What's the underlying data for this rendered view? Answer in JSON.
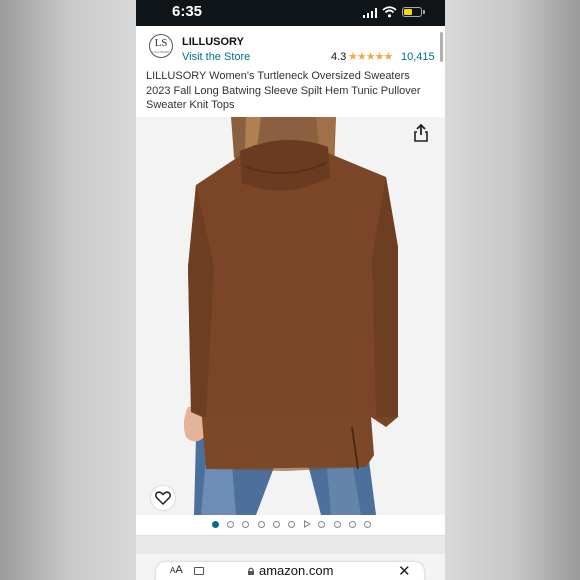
{
  "status": {
    "time": "6:35"
  },
  "brand": {
    "logo_text": "LS",
    "logo_subtext": "LILLUSORY",
    "name": "LILLUSORY",
    "store_link": "Visit the Store"
  },
  "rating": {
    "value": "4.3",
    "stars_out_of_5": 4.3,
    "stars_glyph": "★★★★★",
    "review_count": "10,415"
  },
  "product": {
    "title": "LILLUSORY Women's Turtleneck Oversized Sweaters 2023 Fall Long Batwing Sleeve Spilt Hem Tunic Pullover Sweater Knit Tops",
    "sweater_color": "#7a4627"
  },
  "carousel": {
    "total": 11,
    "active_index": 0,
    "video_index": 6
  },
  "browser": {
    "aa_large": "A",
    "aa_small": "A",
    "url": "amazon.com",
    "close_glyph": "✕"
  },
  "colors": {
    "link": "#007185",
    "star": "#f3a847",
    "status_bar": "#0f1419"
  }
}
